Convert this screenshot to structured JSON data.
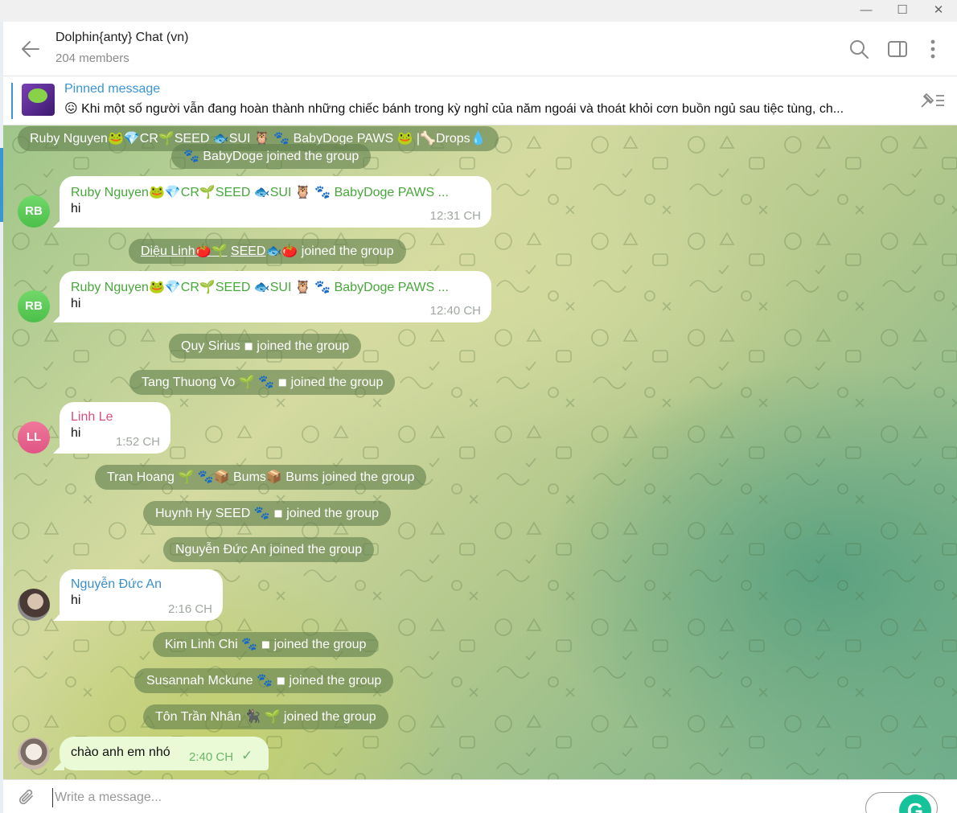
{
  "window": {
    "minimize": "—",
    "maximize": "☐",
    "close": "✕"
  },
  "header": {
    "title": "Dolphin{anty} Chat (vn)",
    "subtitle": "204 members"
  },
  "pinned": {
    "label": "Pinned message",
    "text": "😖 Khi một số người vẫn đang hoàn thành những chiếc bánh trong kỳ nghỉ của năm ngoái và thoát khỏi cơn buồn ngủ sau tiệc tùng, ch..."
  },
  "messages": {
    "svc1": "Ruby Nguyen🐸💎CR🌱SEED 🐟SUI 🦉 🐾 BabyDoge PAWS 🐸 |🦴Drops💧",
    "svc1b": "🐾 BabyDoge joined the group",
    "m1": {
      "avatar": "RB",
      "name": "Ruby Nguyen🐸💎CR🌱SEED 🐟SUI 🦉 🐾 BabyDoge PAWS ...",
      "text": "hi",
      "time": "12:31 CH"
    },
    "svc2": {
      "name": "Diệu Linh🍅🌱",
      "seed": "SEED",
      "tail": "🐟🍅 joined the group"
    },
    "m2": {
      "avatar": "RB",
      "name": "Ruby Nguyen🐸💎CR🌱SEED 🐟SUI 🦉 🐾 BabyDoge PAWS ...",
      "text": "hi",
      "time": "12:40 CH"
    },
    "svc3": "Quy Sirius ◾ joined the group",
    "svc4": "Tang Thuong Vo 🌱 🐾 ◾ joined the group",
    "m3": {
      "avatar": "LL",
      "name": "Linh Le",
      "text": "hi",
      "time": "1:52 CH"
    },
    "svc5": "Tran Hoang 🌱 🐾📦 Bums📦 Bums joined the group",
    "svc6": "Huynh Hy SEED 🐾 ◾ joined the group",
    "svc7": "Nguyễn Đức An joined the group",
    "m4": {
      "name": "Nguyễn Đức An",
      "text": "hi",
      "time": "2:16 CH"
    },
    "svc8": "Kim Linh Chi 🐾 ◾ joined the group",
    "svc9": "Susannah Mckune 🐾 ◾ joined the group",
    "svc10": "Tôn Trần Nhân 🐈‍⬛ 🌱 joined the group",
    "own": {
      "text": "chào anh em nhó",
      "time": "2:40 CH",
      "check": "✓"
    }
  },
  "composer": {
    "placeholder": "Write a message...",
    "grammarly": "G"
  },
  "colors": {
    "accent": "#3a95d5",
    "own_bubble": "#eafad6",
    "service_bg": "#62804e"
  }
}
